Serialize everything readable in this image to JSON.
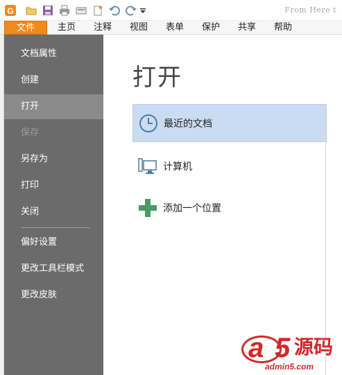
{
  "quick_access": {
    "icons": [
      "app-logo-icon",
      "open-folder-icon",
      "save-icon",
      "print-icon",
      "scan-icon",
      "new-icon",
      "undo-icon",
      "redo-icon",
      "customize-dropdown-icon"
    ],
    "right_text": "From Here t"
  },
  "menubar": {
    "tabs": [
      {
        "label": "文件",
        "active": true
      },
      {
        "label": "主页"
      },
      {
        "label": "注释"
      },
      {
        "label": "视图"
      },
      {
        "label": "表单"
      },
      {
        "label": "保护"
      },
      {
        "label": "共享"
      },
      {
        "label": "帮助"
      }
    ]
  },
  "sidebar": {
    "items": [
      {
        "label": "文档属性"
      },
      {
        "label": "创建"
      },
      {
        "label": "打开",
        "selected": true
      },
      {
        "label": "保存",
        "disabled": true
      },
      {
        "label": "另存为"
      },
      {
        "label": "打印"
      },
      {
        "label": "关闭"
      },
      {
        "label": "偏好设置"
      },
      {
        "label": "更改工具栏模式"
      },
      {
        "label": "更改皮肤"
      }
    ]
  },
  "main": {
    "title": "打开",
    "options": [
      {
        "label": "最近的文档",
        "icon": "clock-icon",
        "selected": true
      },
      {
        "label": "计算机",
        "icon": "computer-icon"
      },
      {
        "label": "添加一个位置",
        "icon": "add-plus-icon"
      }
    ]
  },
  "watermark": {
    "logo_text": "a5源码",
    "url": "admin5.com"
  },
  "colors": {
    "accent": "#f08a1c",
    "sidebar_bg": "#6b6b6b",
    "sidebar_selected": "#8a8a8a",
    "option_selected": "#c9dcf1",
    "plus_green": "#4a9a63",
    "icon_blue": "#4a7aa8",
    "watermark_red": "#d0282a"
  }
}
